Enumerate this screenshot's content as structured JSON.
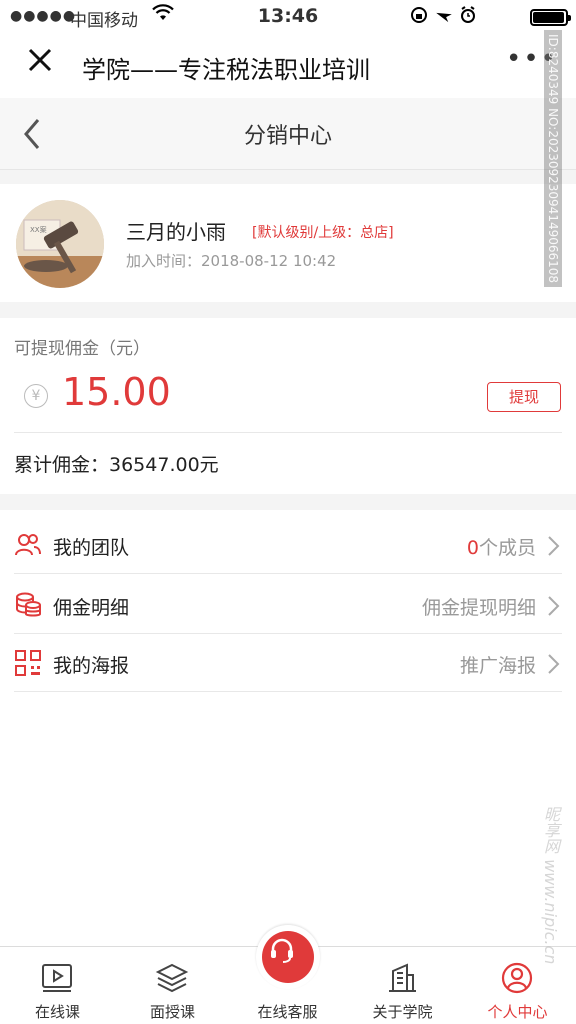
{
  "status": {
    "signal": "●●●●●",
    "carrier": "中国移动",
    "time": "13:46"
  },
  "wechat": {
    "title": "学院——专注税法职业培训",
    "more": "•••"
  },
  "nav": {
    "title": "分销中心"
  },
  "profile": {
    "name": "三月的小雨",
    "level": "[默认级别/上级：总店]",
    "join_time": "加入时间：2018-08-12  10:42",
    "avatar_tag": "XX案"
  },
  "commission": {
    "label": "可提现佣金（元）",
    "currency_symbol": "¥",
    "amount": "15.00",
    "withdraw_button": "提现",
    "total": "累计佣金：36547.00元"
  },
  "menu": [
    {
      "icon": "team-icon",
      "label": "我的团队",
      "count": "0",
      "suffix": "个成员"
    },
    {
      "icon": "coins-icon",
      "label": "佣金明细",
      "value": "佣金提现明细"
    },
    {
      "icon": "qrcode-icon",
      "label": "我的海报",
      "value": "推广海报"
    }
  ],
  "tabs": [
    {
      "label": "在线课",
      "icon": "video-icon"
    },
    {
      "label": "面授课",
      "icon": "layers-icon"
    },
    {
      "label": "在线客服",
      "icon": "headset-icon"
    },
    {
      "label": "关于学院",
      "icon": "building-icon"
    },
    {
      "label": "个人中心",
      "icon": "user-icon",
      "active": true
    }
  ],
  "colors": {
    "accent": "#e03a3a",
    "text": "#222222",
    "muted": "#999999",
    "background": "#f4f4f4"
  },
  "watermark": {
    "id": "ID:8240349 NO:20230923094149066108",
    "site": "昵享网 www.nipic.cn"
  }
}
